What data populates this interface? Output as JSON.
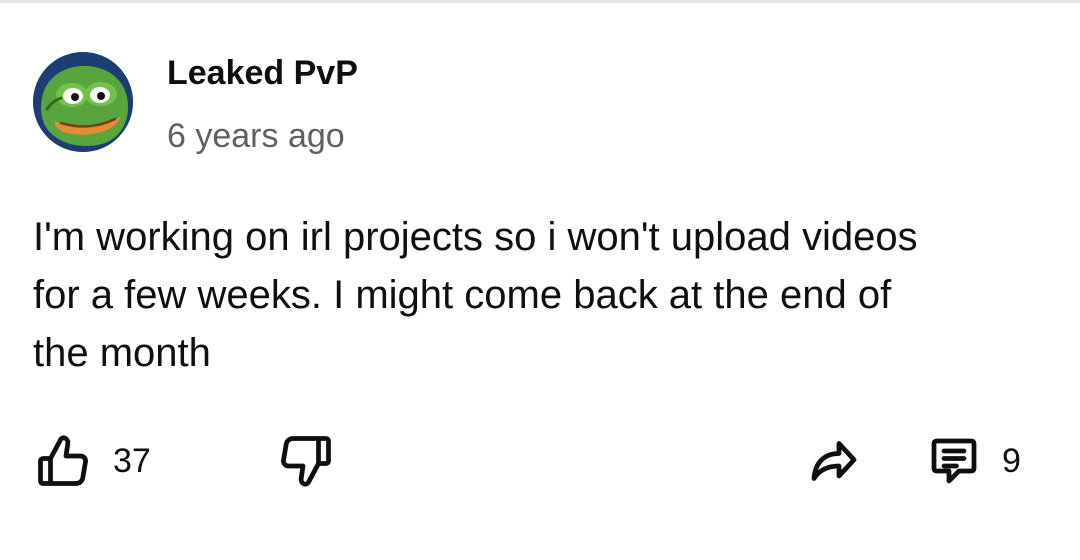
{
  "comment": {
    "author": "Leaked PvP",
    "timestamp": "6 years ago",
    "text": "I'm working on irl projects so i won't upload videos\nfor a few weeks. I might come back at the end of\nthe month",
    "avatar_icon": "pepe-frog-avatar"
  },
  "actions": {
    "like_count": "37",
    "reply_count": "9",
    "icons": {
      "like": "thumbs-up-icon",
      "dislike": "thumbs-down-icon",
      "share": "share-arrow-icon",
      "reply": "comment-bubble-icon"
    }
  },
  "colors": {
    "text_primary": "#0f0f0f",
    "text_secondary": "#606060",
    "divider": "#e5e5e5",
    "background": "#ffffff"
  }
}
